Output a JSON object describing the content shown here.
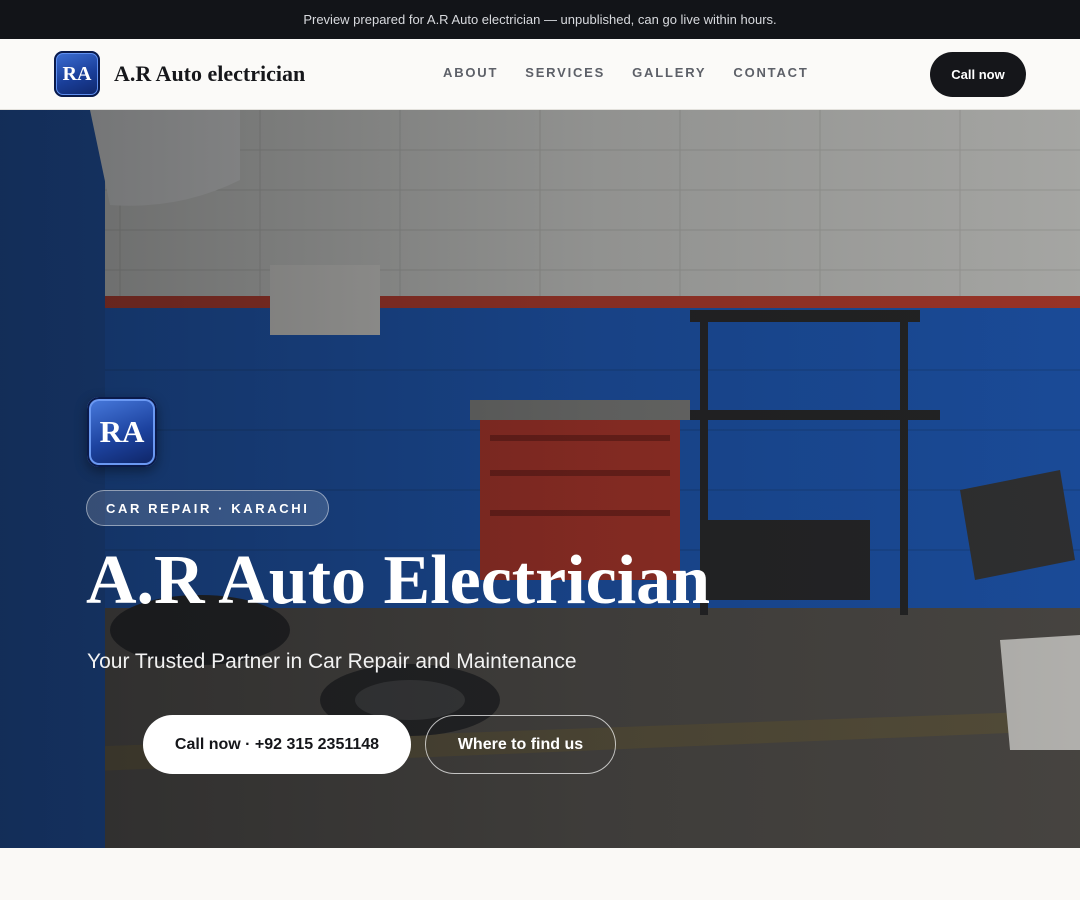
{
  "topbar": {
    "text": "Preview prepared for A.R Auto electrician — unpublished, can go live within hours."
  },
  "header": {
    "logo_text": "RA",
    "brand_name": "A.R Auto electrician",
    "nav": [
      {
        "label": "ABOUT"
      },
      {
        "label": "SERVICES"
      },
      {
        "label": "GALLERY"
      },
      {
        "label": "CONTACT"
      }
    ],
    "call_label": "Call now"
  },
  "hero": {
    "logo_text": "RA",
    "tag": "CAR REPAIR · KARACHI",
    "title": "A.R Auto Electrician",
    "subtitle": "Your Trusted Partner in Car Repair and Maintenance",
    "primary_cta": "Call now · +92 315 2351148",
    "secondary_cta": "Where to find us"
  },
  "colors": {
    "dark": "#15161a",
    "logo_blue": "#1a3f9a",
    "wall_blue": "#1f5fc4",
    "toolbox_red": "#c0392b"
  }
}
